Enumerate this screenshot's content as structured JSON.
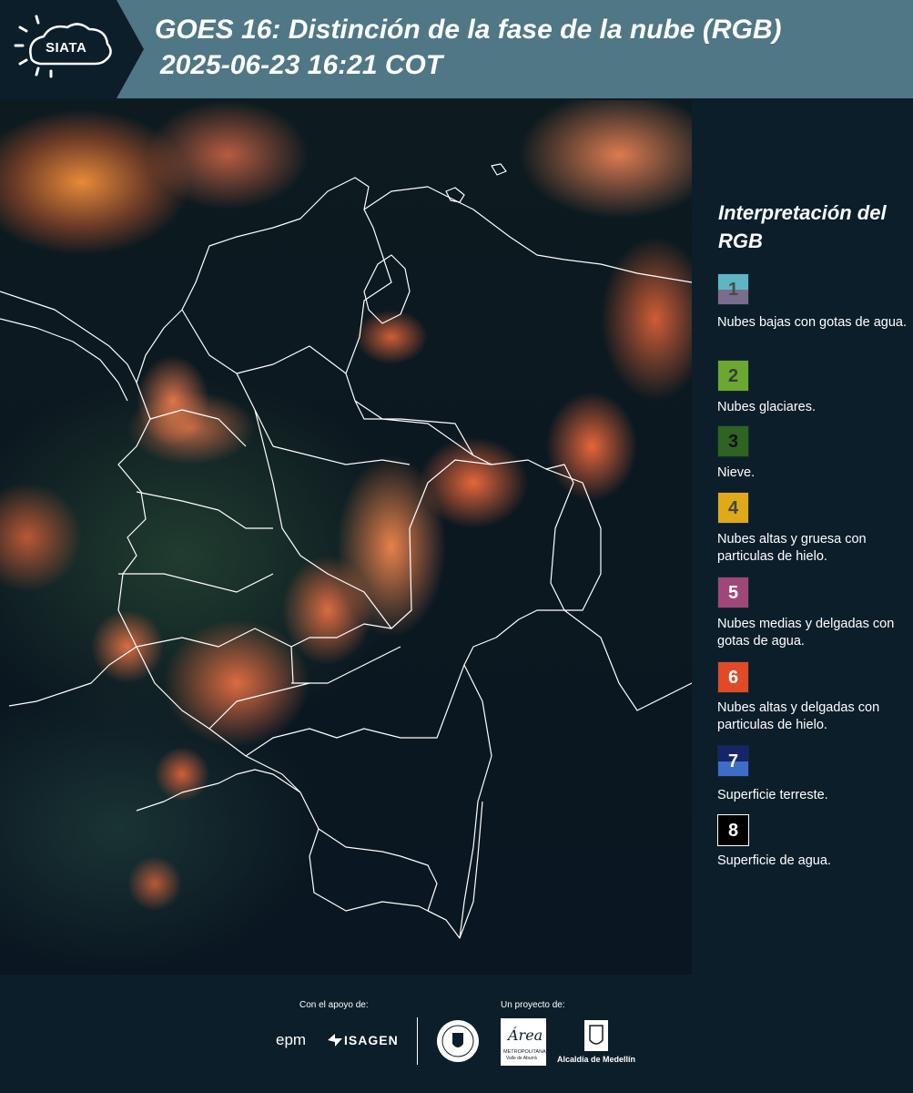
{
  "header": {
    "logo_text": "SIATA",
    "title_line1": "GOES 16: Distinción de la fase de la nube (RGB)",
    "title_line2": "2025-06-23 16:21 COT",
    "bg_color": "#4f7785"
  },
  "legend": {
    "title": "Interpretación del RGB",
    "items": [
      {
        "number": "1",
        "label": "Nubes bajas con gotas de agua.",
        "color_top": "#5fb5c4",
        "color_bottom": "#7a6e8c",
        "number_color": "#4a4a4a"
      },
      {
        "number": "2",
        "label": "Nubes glaciares.",
        "color_top": "#6aa832",
        "color_bottom": "#6aa832",
        "number_color": "#3a3a3a"
      },
      {
        "number": "3",
        "label": "Nieve.",
        "color_top": "#2e6322",
        "color_bottom": "#2e6322",
        "number_color": "#111111"
      },
      {
        "number": "4",
        "label": "Nubes altas y gruesa con particulas de hielo.",
        "color_top": "#e0a91a",
        "color_bottom": "#e0a91a",
        "number_color": "#444444"
      },
      {
        "number": "5",
        "label": "Nubes medias y delgadas con gotas de agua.",
        "color_top": "#a0477a",
        "color_bottom": "#a0477a",
        "number_color": "#ffffff"
      },
      {
        "number": "6",
        "label": "Nubes altas y delgadas con particulas de hielo.",
        "color_top": "#e04a26",
        "color_bottom": "#e04a26",
        "number_color": "#ffffff"
      },
      {
        "number": "7",
        "label": "Superficie terreste.",
        "color_top": "#14256a",
        "color_bottom": "#3e6cc8",
        "number_color": "#ffffff"
      },
      {
        "number": "8",
        "label": "Superficie de agua.",
        "color_top": "#000000",
        "color_bottom": "#000000",
        "number_color": "#ffffff"
      }
    ]
  },
  "footer": {
    "support_label": "Con el apoyo de:",
    "project_label": "Un proyecto de:",
    "epm": "epm",
    "isagen": "ISAGEN",
    "area_name": "Área",
    "area_sub": "METROPOLITANA",
    "area_sub2": "Valle de Aburrá",
    "alcaldia": "Alcaldía de Medellín"
  }
}
